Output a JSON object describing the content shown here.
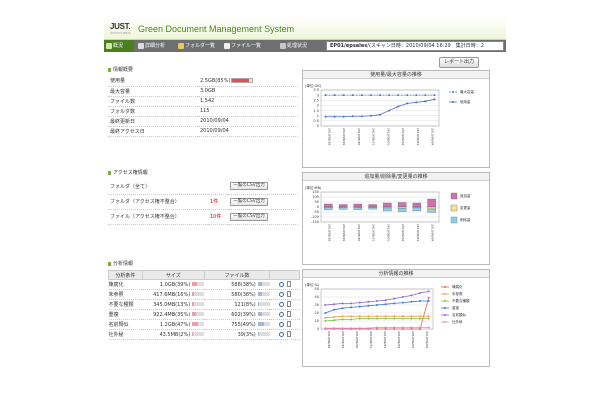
{
  "app": {
    "logo": "JUST.",
    "logo_sub": "JUSTSYSTEMS",
    "title": "Green Document Management System"
  },
  "nav": {
    "items": [
      {
        "label": "概況",
        "active": true
      },
      {
        "label": "詳細分析",
        "active": false
      },
      {
        "label": "フォルダ一覧",
        "active": false
      },
      {
        "label": "ファイル一覧",
        "active": false
      },
      {
        "label": "処理状況",
        "active": false
      }
    ],
    "status_server": "EP01/epsales",
    "status_text": "/(スキャン日時：2010/09/04 16:29　集計日時：2"
  },
  "report_button": "レポート出力",
  "info": {
    "title": "情報概要",
    "rows": [
      {
        "label": "使用量",
        "value": "2.5GB(85%)",
        "percent": 85
      },
      {
        "label": "最大容量",
        "value": "3.0GB"
      },
      {
        "label": "ファイル数",
        "value": "1,542"
      },
      {
        "label": "フォルダ数",
        "value": "115"
      },
      {
        "label": "最終更新日",
        "value": "2010/09/04"
      },
      {
        "label": "最終アクセス日",
        "value": "2010/09/04"
      }
    ]
  },
  "access": {
    "title": "アクセス権情報",
    "rows": [
      {
        "label": "フォルダ（全て）",
        "count": "",
        "button": "一覧のCSV出力"
      },
      {
        "label": "フォルダ（アクセス権不整合）",
        "count": "1件",
        "button": "一覧のCSV出力"
      },
      {
        "label": "ファイル（アクセス権不整合）",
        "count": "10件",
        "button": "一覧のCSV出力"
      }
    ]
  },
  "analysis": {
    "title": "分析情報",
    "headers": [
      "分析条件",
      "サイズ",
      "ファイル数"
    ],
    "rows": [
      {
        "name": "陳腐化",
        "size": "1.0GB(39%)",
        "size_pct": 39,
        "files": "588(38%)",
        "files_pct": 38
      },
      {
        "name": "未参照",
        "size": "417.6MB(16%)",
        "size_pct": 16,
        "files": "580(38%)",
        "files_pct": 38
      },
      {
        "name": "不要な種類",
        "size": "345.0MB(13%)",
        "size_pct": 13,
        "files": "121(8%)",
        "files_pct": 8
      },
      {
        "name": "重複",
        "size": "922.4MB(35%)",
        "size_pct": 35,
        "files": "602(39%)",
        "files_pct": 39
      },
      {
        "name": "名前類似",
        "size": "1.2GB(47%)",
        "size_pct": 47,
        "files": "755(49%)",
        "files_pct": 49
      },
      {
        "name": "社外秘",
        "size": "43.5MB(2%)",
        "size_pct": 2,
        "files": "39(3%)",
        "files_pct": 3
      }
    ]
  },
  "colors": {
    "accent_green": "#4a7e1e",
    "nav_bg": "#6f6f6f",
    "size_bar": "#e8a0a8",
    "files_bar": "#9fb8d8",
    "usage_bar": "#d9534f"
  },
  "chart_data": [
    {
      "type": "line",
      "title": "使用量/最大容量の推移",
      "unit": "(単位:GB)",
      "ylim": [
        0,
        3.5
      ],
      "yticks": [
        "3.5",
        "3",
        "2.5",
        "2",
        "1.5",
        "1",
        "0.5",
        "0"
      ],
      "categories": [
        "2010/08/28",
        "2010/08/29",
        "2010/08/30",
        "2010/08/31",
        "2010/09/01",
        "2010/09/02",
        "2010/09/03",
        "2010/09/04"
      ],
      "series": [
        {
          "name": "最大容量",
          "color": "#4a6fc4",
          "dashed": true,
          "values": [
            3.0,
            3.0,
            3.0,
            3.0,
            3.0,
            3.0,
            3.0,
            3.0,
            3.0,
            3.0,
            3.0,
            3.0,
            3.0
          ]
        },
        {
          "name": "使用量",
          "color": "#4a6fc4",
          "dashed": false,
          "values": [
            0.9,
            0.9,
            0.9,
            0.95,
            0.95,
            1.0,
            1.1,
            1.5,
            1.9,
            2.2,
            2.3,
            2.4,
            2.6
          ]
        }
      ]
    },
    {
      "type": "bar",
      "title": "追加量/削除量/変更量の推移",
      "unit": "(単位:MB)",
      "ylim": [
        -150,
        150
      ],
      "yticks": [
        "150",
        "100",
        "50",
        "0",
        "-50",
        "-100",
        "-150"
      ],
      "categories": [
        "2010/08/28",
        "2010/08/29",
        "2010/08/30",
        "2010/08/31",
        "2010/09/01",
        "2010/09/02",
        "2010/09/03",
        "2010/09/04"
      ],
      "series": [
        {
          "name": "追加量",
          "color": "#d070b0",
          "values": [
            30,
            25,
            30,
            25,
            40,
            45,
            40,
            80
          ]
        },
        {
          "name": "変更量",
          "color": "#f3e28a",
          "values": [
            -8,
            -6,
            -8,
            -6,
            -10,
            -12,
            -9,
            -20
          ]
        },
        {
          "name": "削除量",
          "color": "#8fd0e8",
          "values": [
            -20,
            -18,
            -20,
            -15,
            -30,
            -35,
            -30,
            -35
          ]
        }
      ]
    },
    {
      "type": "line",
      "title": "分析情報の推移",
      "unit": "(単位:%)",
      "ylim": [
        0,
        50
      ],
      "yticks": [
        "50",
        "40",
        "30",
        "20",
        "10",
        "0"
      ],
      "categories": [
        "2010/08/28",
        "2010/08/29",
        "2010/08/30",
        "2010/08/31",
        "2010/09/01",
        "2010/09/02",
        "2010/09/03",
        "2010/09/04"
      ],
      "series": [
        {
          "name": "陳腐化",
          "color": "#e86060",
          "values": [
            0,
            0,
            0,
            0,
            0,
            0,
            0,
            0,
            0,
            0,
            0,
            0,
            39
          ]
        },
        {
          "name": "未参照",
          "color": "#f0a030",
          "values": [
            14,
            15,
            16,
            16,
            16,
            16,
            16,
            16,
            16,
            16,
            16,
            16,
            16
          ]
        },
        {
          "name": "不要な種類",
          "color": "#7fc24a",
          "values": [
            10,
            11,
            12,
            12,
            13,
            13,
            13,
            13,
            13,
            13,
            13,
            13,
            13
          ]
        },
        {
          "name": "重複",
          "color": "#3a7ad0",
          "values": [
            20,
            24,
            26,
            27,
            28,
            29,
            30,
            31,
            32,
            33,
            34,
            35,
            35
          ]
        },
        {
          "name": "名前類似",
          "color": "#8a6ad0",
          "values": [
            30,
            31,
            32,
            32,
            33,
            34,
            35,
            36,
            38,
            40,
            42,
            45,
            47
          ]
        },
        {
          "name": "社外秘",
          "color": "#e088c0",
          "values": [
            1,
            1,
            1,
            1,
            1,
            1,
            2,
            2,
            2,
            2,
            2,
            2,
            2
          ]
        }
      ]
    }
  ]
}
